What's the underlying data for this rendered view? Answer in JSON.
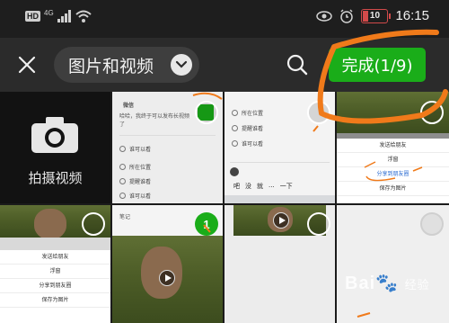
{
  "status_bar": {
    "hd": "HD",
    "network": "4G",
    "battery": "10",
    "time": "16:15"
  },
  "toolbar": {
    "album_label": "图片和视频",
    "done_label": "完成(1/9)"
  },
  "grid": {
    "camera_label": "拍摄视频",
    "selected_number": "1",
    "shot_a": {
      "header": "微信",
      "text": "哈哈，我终于可以发布长视频了",
      "rows": [
        "谁可以看",
        "所在位置",
        "提醒谁看",
        "谁可以看"
      ]
    },
    "shot_b": {
      "rows": [
        "所在位置",
        "提醒谁看",
        "谁可以看"
      ],
      "keyboard": [
        "吧",
        "没",
        "就",
        "...",
        "一下"
      ]
    },
    "shot_c": {
      "sheet": [
        "发送给朋友",
        "浮窗",
        "分享到朋友圈",
        "保存为图片"
      ]
    },
    "shot_d": {
      "sheet": [
        "发送给朋友",
        "浮窗",
        "分享到朋友圈",
        "保存为图片"
      ]
    },
    "shot_e": {
      "header": "笔记"
    }
  },
  "watermark": {
    "brand": "Bai",
    "suffix": "经验"
  },
  "colors": {
    "accent_green": "#1aad19",
    "annotation_orange": "#f07a1a"
  }
}
